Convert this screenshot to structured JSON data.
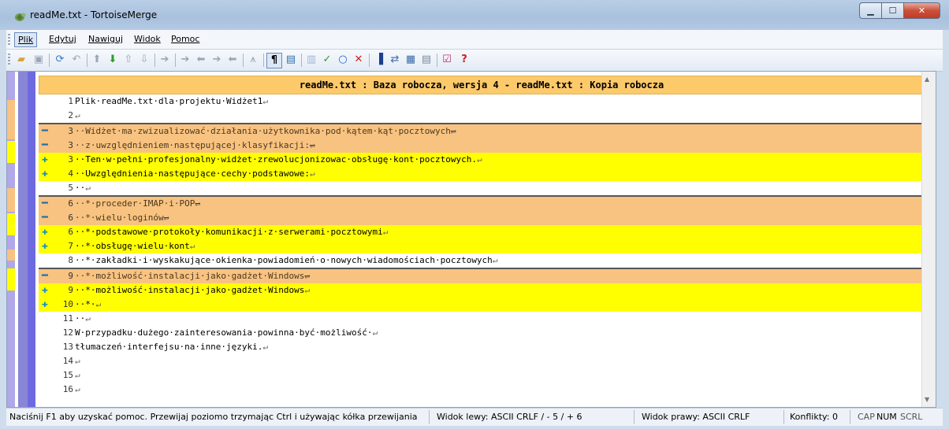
{
  "window": {
    "title": "readMe.txt - TortoiseMerge"
  },
  "menu": [
    "Plik",
    "Edytuj",
    "Nawiguj",
    "Widok",
    "Pomoc"
  ],
  "header": "readMe.txt : Baza robocza, wersja 4 - readMe.txt : Kopia robocza",
  "lines": [
    {
      "num": "1",
      "type": "normal",
      "text": "Plik·readMe.txt·dla·projektu·Widżet1"
    },
    {
      "num": "2",
      "type": "normal",
      "text": ""
    },
    {
      "num": "3",
      "type": "removed",
      "text": "··Widżet·ma·zwizualizować·działania·użytkownika·pod·kątem·kąt·pocztowych"
    },
    {
      "num": "3",
      "type": "removed",
      "text": "··z·uwzględnieniem·następującej·klasyfikacji:"
    },
    {
      "num": "3",
      "type": "added",
      "text": "··Ten·w·pełni·profesjonalny·widżet·zrewolucjonizowac·obsługę·kont·pocztowych."
    },
    {
      "num": "4",
      "type": "added",
      "text": "··Uwzględnienia·następujące·cechy·podstawowe:"
    },
    {
      "num": "5",
      "type": "normal",
      "text": "··"
    },
    {
      "num": "6",
      "type": "removed",
      "text": "··*·proceder·IMAP·i·POP"
    },
    {
      "num": "6",
      "type": "removed",
      "text": "··*·wielu·loginów"
    },
    {
      "num": "6",
      "type": "added",
      "text": "··*·podstawowe·protokoły·komunikacji·z·serwerami·pocztowymi"
    },
    {
      "num": "7",
      "type": "added",
      "text": "··*·obsługę·wielu·kont"
    },
    {
      "num": "8",
      "type": "normal",
      "text": "··*·zakładki·i·wyskakujące·okienka·powiadomień·o·nowych·wiadomościach·pocztowych"
    },
    {
      "num": "9",
      "type": "removed",
      "text": "··*·możliwość·instalacji·jako·gadżet·Windows"
    },
    {
      "num": "9",
      "type": "added",
      "text": "··*·możliwość·instalacji·jako·gadżet·Windows"
    },
    {
      "num": "10",
      "type": "added",
      "text": "··*·"
    },
    {
      "num": "11",
      "type": "normal",
      "text": "··"
    },
    {
      "num": "12",
      "type": "normal",
      "text": "W·przypadku·dużego·zainteresowania·powinna·być·możliwość·"
    },
    {
      "num": "13",
      "type": "normal",
      "text": "tłumaczeń·interfejsu·na·inne·języki."
    },
    {
      "num": "14",
      "type": "normal",
      "text": ""
    },
    {
      "num": "15",
      "type": "normal",
      "text": ""
    },
    {
      "num": "16",
      "type": "normal",
      "text": ""
    }
  ],
  "eol_glyph": "↵",
  "status": {
    "help": "Naciśnij F1 aby uzyskać pomoc. Przewijaj poziomo trzymając Ctrl i używając kółka przewijania",
    "left_view": "Widok lewy: ASCII CRLF  / - 5 / + 6",
    "right_view": "Widok prawy: ASCII CRLF",
    "conflicts": "Konflikty: 0",
    "cap": "CAP",
    "num": "NUM",
    "scrl": "SCRL"
  },
  "colors": {
    "removed": "#f8c280",
    "added": "#ffff00",
    "header": "#fdca6b",
    "locator": "#b0a8e8"
  }
}
